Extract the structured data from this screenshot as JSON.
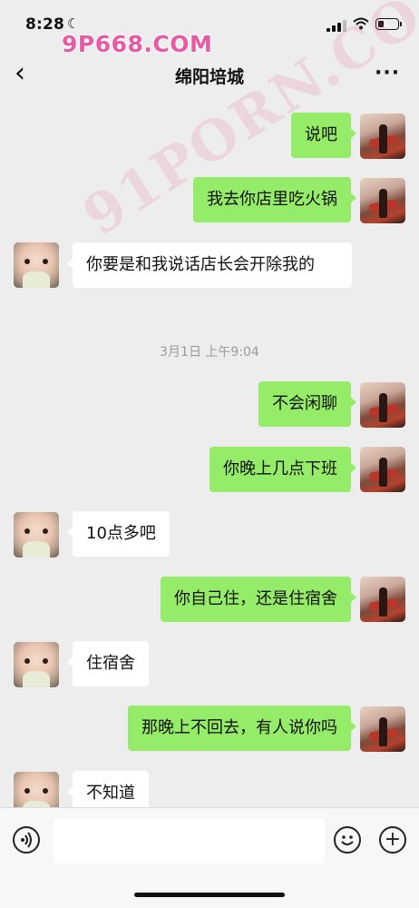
{
  "status_bar": {
    "time": "8:28",
    "moon_glyph": "☾",
    "wifi_glyph": "◔",
    "signal_bars": 3,
    "battery_level": 0.3,
    "watermark": "9P668.COM"
  },
  "nav": {
    "back_glyph": "‹",
    "title": "绵阳培城",
    "more_glyph": "···"
  },
  "watermark_diag": "91PORN.COM",
  "timestamp": "3月1日 上午9:04",
  "messages": [
    {
      "from": "me",
      "text": "说吧"
    },
    {
      "from": "me",
      "text": "我去你店里吃火锅"
    },
    {
      "from": "them",
      "text": "你要是和我说话店长会开除我的"
    },
    {
      "from": "me",
      "text": "不会闲聊"
    },
    {
      "from": "me",
      "text": "你晚上几点下班"
    },
    {
      "from": "them",
      "text": "10点多吧"
    },
    {
      "from": "me",
      "text": "你自己住，还是住宿舍"
    },
    {
      "from": "them",
      "text": "住宿舍"
    },
    {
      "from": "me",
      "text": "那晚上不回去，有人说你吗"
    },
    {
      "from": "them",
      "text": "不知道"
    }
  ],
  "input_bar": {
    "voice_glyph": "◉",
    "emoji_glyph": "☺",
    "plus_glyph": "+",
    "placeholder": ""
  },
  "colors": {
    "me_bubble": "#95ec69",
    "them_bubble": "#ffffff",
    "background": "#ededed"
  }
}
